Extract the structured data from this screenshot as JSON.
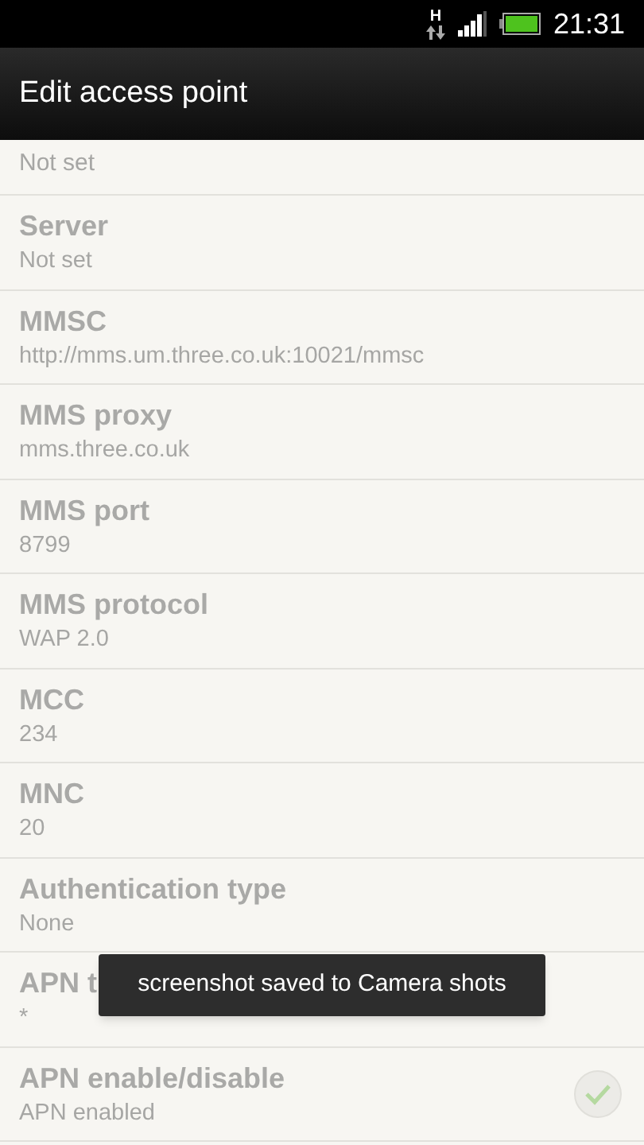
{
  "status_bar": {
    "network": "H",
    "time": "21:31"
  },
  "header": {
    "title": "Edit access point"
  },
  "settings": [
    {
      "kind": "partial",
      "value": "Not set",
      "disabled": true
    },
    {
      "kind": "text",
      "title": "Server",
      "value": "Not set",
      "disabled": true
    },
    {
      "kind": "text",
      "title": "MMSC",
      "value": "http://mms.um.three.co.uk:10021/mmsc",
      "disabled": true
    },
    {
      "kind": "text",
      "title": "MMS proxy",
      "value": "mms.three.co.uk",
      "disabled": true
    },
    {
      "kind": "text",
      "title": "MMS port",
      "value": "8799",
      "disabled": true
    },
    {
      "kind": "text",
      "title": "MMS protocol",
      "value": "WAP 2.0",
      "disabled": true
    },
    {
      "kind": "text",
      "title": "MCC",
      "value": "234",
      "disabled": true
    },
    {
      "kind": "text",
      "title": "MNC",
      "value": "20",
      "disabled": true
    },
    {
      "kind": "text",
      "title": "Authentication type",
      "value": "None",
      "disabled": true
    },
    {
      "kind": "text",
      "title": "APN t",
      "value": "*",
      "disabled": true
    },
    {
      "kind": "checkbox",
      "title": "APN enable/disable",
      "value": "APN enabled",
      "disabled": true,
      "checked": true
    }
  ],
  "toast": {
    "text": "screenshot saved to Camera shots"
  }
}
